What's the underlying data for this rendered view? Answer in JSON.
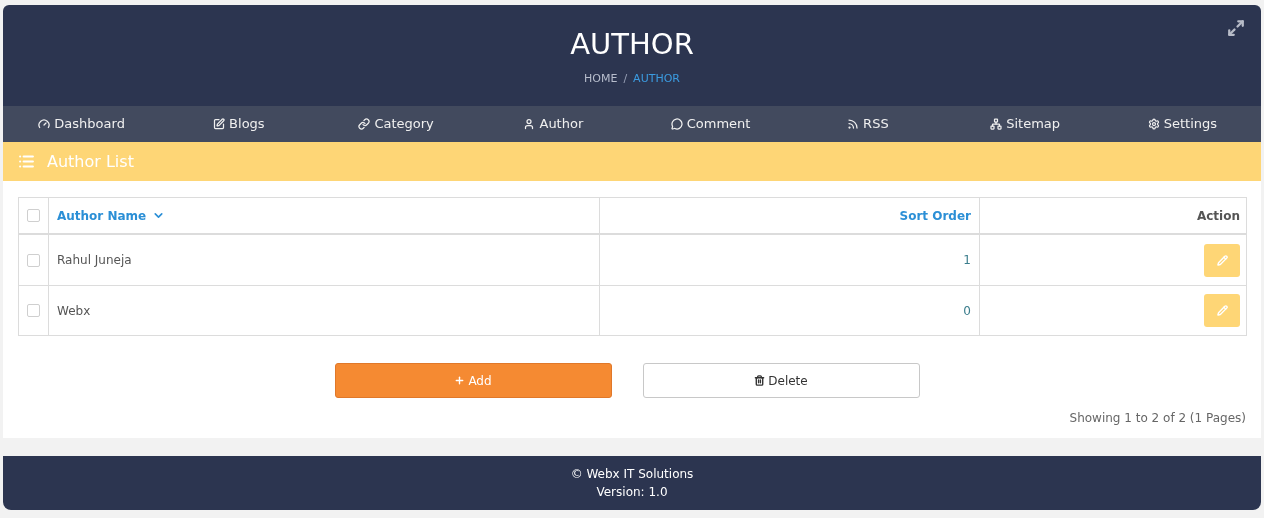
{
  "header": {
    "title": "AUTHOR",
    "breadcrumb_separator": "/",
    "breadcrumb": [
      {
        "label": "HOME",
        "selected": false
      },
      {
        "label": "AUTHOR",
        "selected": true
      }
    ]
  },
  "nav": [
    {
      "label": "Dashboard",
      "kind": "dashboard"
    },
    {
      "label": "Blogs",
      "kind": "blogs"
    },
    {
      "label": "Category",
      "kind": "category"
    },
    {
      "label": "Author",
      "kind": "author"
    },
    {
      "label": "Comment",
      "kind": "comment"
    },
    {
      "label": "RSS",
      "kind": "rss"
    },
    {
      "label": "Sitemap",
      "kind": "sitemap"
    },
    {
      "label": "Settings",
      "kind": "settings"
    }
  ],
  "panel": {
    "title": "Author List"
  },
  "table": {
    "select_all": {
      "checked": false
    },
    "columns": [
      {
        "label": "Author Name",
        "sortable": true,
        "sorted": true
      },
      {
        "label": "Sort Order",
        "sortable": true,
        "sorted": false
      },
      {
        "label": "Action",
        "sortable": false,
        "sorted": false
      }
    ],
    "rows": [
      {
        "checked": false,
        "name": "Rahul Juneja",
        "sort_order": "1"
      },
      {
        "checked": false,
        "name": "Webx",
        "sort_order": "0"
      }
    ]
  },
  "buttons": [
    {
      "label": "Add",
      "kind": "add"
    },
    {
      "label": "Delete",
      "kind": "delete"
    }
  ],
  "pagination": "Showing 1 to 2 of 2 (1 Pages)",
  "footer": {
    "copyright": "© Webx IT Solutions",
    "version": "Version: 1.0"
  }
}
